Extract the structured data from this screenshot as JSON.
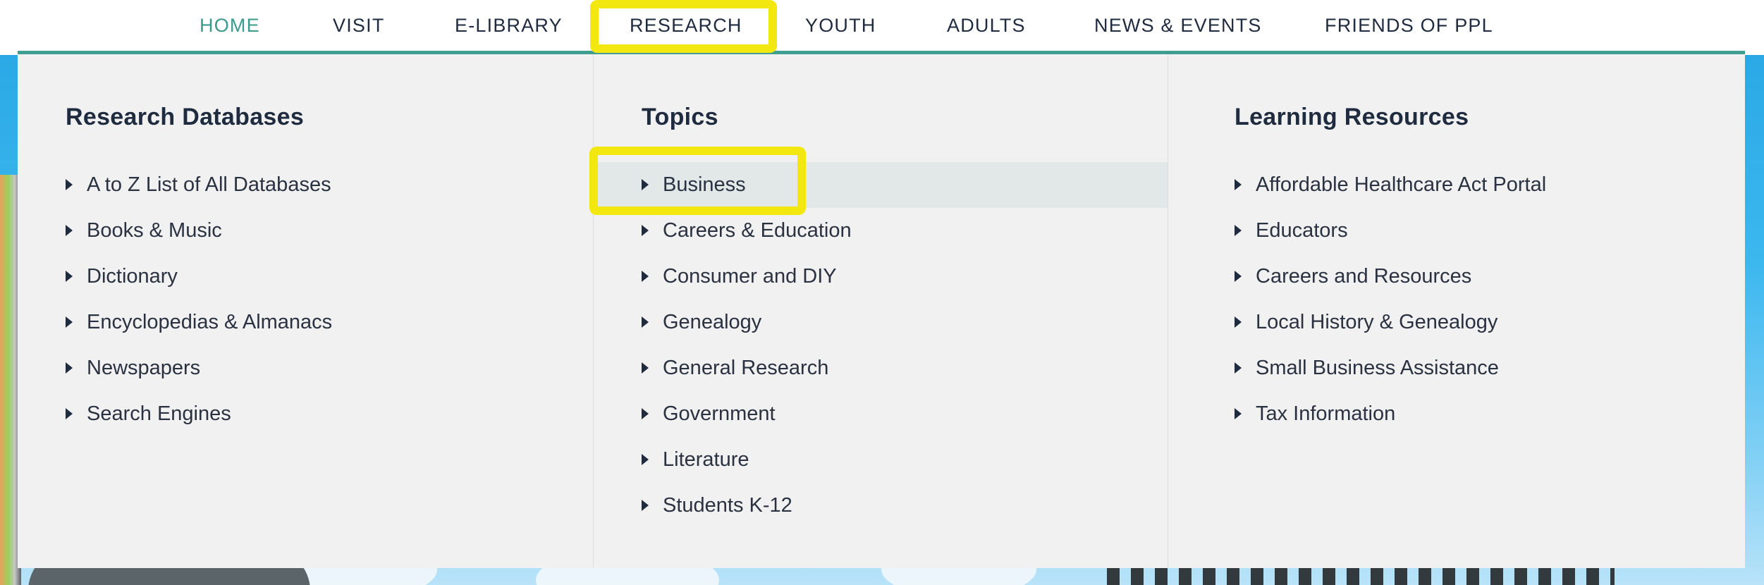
{
  "nav": {
    "items": [
      {
        "label": "HOME"
      },
      {
        "label": "VISIT"
      },
      {
        "label": "E-LIBRARY"
      },
      {
        "label": "RESEARCH"
      },
      {
        "label": "YOUTH"
      },
      {
        "label": "ADULTS"
      },
      {
        "label": "NEWS & EVENTS"
      },
      {
        "label": "FRIENDS OF PPL"
      }
    ],
    "active": "HOME",
    "highlighted": "RESEARCH"
  },
  "mega_menu": {
    "columns": [
      {
        "heading": "Research Databases",
        "items": [
          "A to Z List of All Databases",
          "Books & Music",
          "Dictionary",
          "Encyclopedias & Almanacs",
          "Newspapers",
          "Search Engines"
        ]
      },
      {
        "heading": "Topics",
        "items": [
          "Business",
          "Careers & Education",
          "Consumer and DIY",
          "Genealogy",
          "General Research",
          "Government",
          "Literature",
          "Students K-12"
        ],
        "hovered": "Business"
      },
      {
        "heading": "Learning Resources",
        "items": [
          "Affordable Healthcare Act Portal",
          "Educators",
          "Careers and Resources",
          "Local History & Genealogy",
          "Small Business Assistance",
          "Tax Information"
        ]
      }
    ]
  },
  "colors": {
    "accent": "#3f9e90",
    "active_nav": "#3a9a8c",
    "highlight": "#f2e70f",
    "text": "#1f2b3f"
  }
}
